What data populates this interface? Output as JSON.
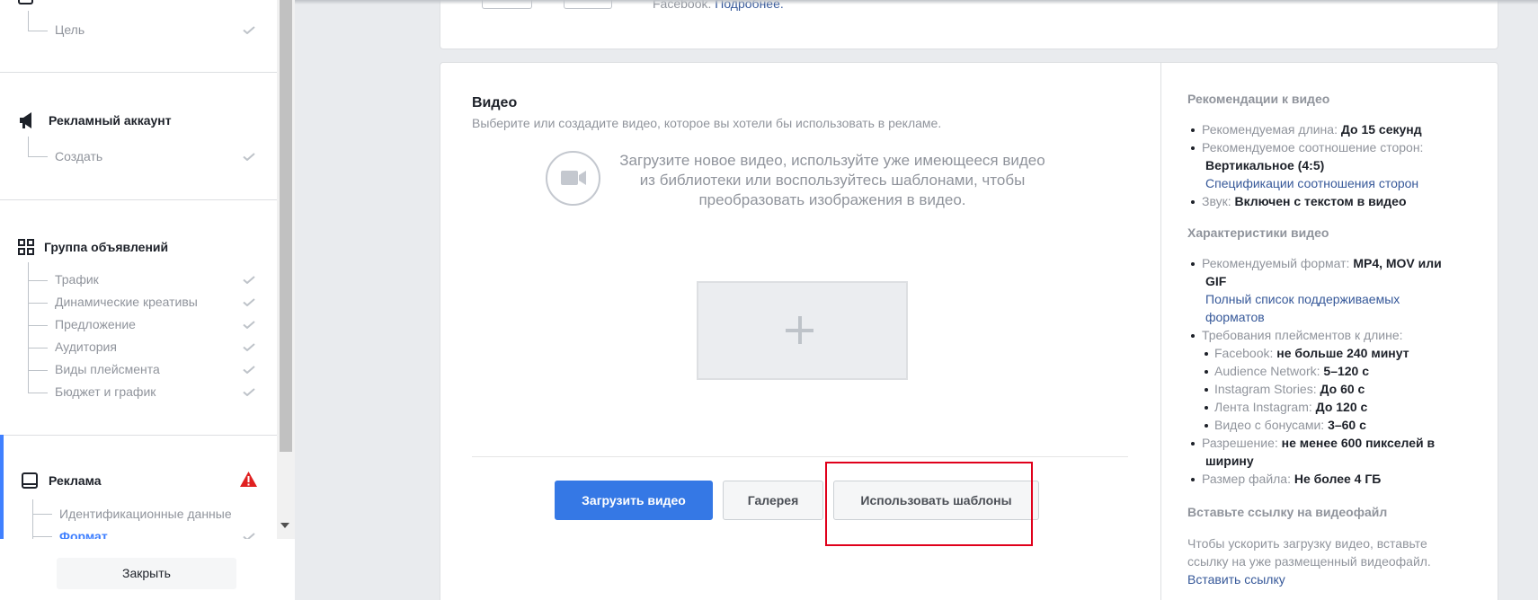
{
  "sidebar": {
    "campaign_sub": "Цель",
    "ad_account": {
      "title": "Рекламный аккаунт",
      "sub": "Создать"
    },
    "ad_group": {
      "title": "Группа объявлений",
      "items": [
        "Трафик",
        "Динамические креативы",
        "Предложение",
        "Аудитория",
        "Виды плейсмента",
        "Бюджет и график"
      ]
    },
    "ad": {
      "title": "Реклама",
      "items": [
        "Идентификационные данные",
        "Формат"
      ]
    },
    "close_label": "Закрыть"
  },
  "top_card": {
    "text": "Facebook.",
    "link": "Подробнее."
  },
  "video": {
    "title": "Видео",
    "subtitle": "Выберите или создадите видео, которое вы хотели бы использовать в рекламе.",
    "prompt_line1": "Загрузите новое видео, используйте уже имеющееся видео",
    "prompt_line2": "из библиотеки или воспользуйтесь шаблонами, чтобы",
    "prompt_line3": "преобразовать изображения в видео.",
    "btn_upload": "Загрузить видео",
    "btn_gallery": "Галерея",
    "btn_templates": "Использовать шаблоны"
  },
  "recommendations": {
    "title": "Рекомендации к видео",
    "length_label": "Рекомендуемая длина: ",
    "length_value": "До 15 секунд",
    "ratio_label": "Рекомендуемое соотношение сторон:",
    "ratio_value": "Вертикальное (4:5)",
    "ratio_link": "Спецификации соотношения сторон",
    "sound_label": "Звук: ",
    "sound_value": "Включен с текстом в видео"
  },
  "characteristics": {
    "title": "Характеристики видео",
    "format_label": "Рекомендуемый формат: ",
    "format_value_1": "MP4, MOV или",
    "format_value_2": "GIF",
    "formats_link_1": "Полный список поддерживаемых",
    "formats_link_2": "форматов",
    "placement_label": "Требования плейсментов к длине:",
    "placements": [
      {
        "label": "Facebook: ",
        "value": "не больше 240 минут"
      },
      {
        "label": "Audience Network: ",
        "value": "5–120 с"
      },
      {
        "label": "Instagram Stories: ",
        "value": "До 60 с"
      },
      {
        "label": "Лента Instagram: ",
        "value": "До 120 с"
      },
      {
        "label": "Видео с бонусами: ",
        "value": "3–60 с"
      }
    ],
    "resolution_label": "Разрешение: ",
    "resolution_value_1": "не менее 600 пикселей в",
    "resolution_value_2": "ширину",
    "size_label": "Размер файла: ",
    "size_value": "Не более 4 ГБ"
  },
  "link_section": {
    "title": "Вставьте ссылку на видеофайл",
    "text_1": "Чтобы ускорить загрузку видео, вставьте",
    "text_2": "ссылку на уже размещенный видеофайл.",
    "link": "Вставить ссылку"
  },
  "colors": {
    "primary": "#3578e5",
    "highlight": "#e0001b",
    "link": "#365899",
    "warning": "#e02020"
  }
}
